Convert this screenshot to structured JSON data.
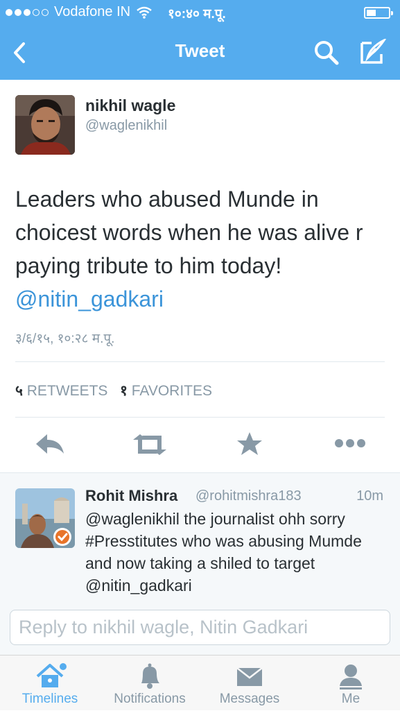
{
  "status_bar": {
    "carrier": "Vodafone IN",
    "time": "१०:४० म.पू.",
    "signal_bars": 5,
    "signal_filled": 3
  },
  "nav": {
    "title": "Tweet",
    "back_icon": "chevron-left-icon",
    "search_icon": "search-icon",
    "compose_icon": "compose-icon"
  },
  "tweet": {
    "author_name": "nikhil wagle",
    "author_handle": "@waglenikhil",
    "text": "Leaders who abused Munde in choicest words when he was alive r paying tribute to him today!",
    "mention": "@nitin_gadkari",
    "timestamp": "३/६/१५, १०:२८ म.पू.",
    "retweets_count": "५",
    "retweets_label": "RETWEETS",
    "favorites_count": "१",
    "favorites_label": "FAVORITES"
  },
  "actions": {
    "reply_icon": "reply-icon",
    "retweet_icon": "retweet-icon",
    "favorite_icon": "star-icon",
    "more_icon": "more-icon"
  },
  "reply": {
    "name": "Rohit Mishra",
    "handle": "@rohitmishra183",
    "time": "10m",
    "text": "@waglenikhil the journalist ohh sorry #Presstitutes who was abusing Mumde and now taking a shiled to target  @nitin_gadkari"
  },
  "compose": {
    "placeholder": "Reply to nikhil wagle, Nitin Gadkari"
  },
  "tabs": [
    {
      "label": "Timelines",
      "icon": "home-icon",
      "active": true
    },
    {
      "label": "Notifications",
      "icon": "bell-icon",
      "active": false
    },
    {
      "label": "Messages",
      "icon": "envelope-icon",
      "active": false
    },
    {
      "label": "Me",
      "icon": "person-icon",
      "active": false
    }
  ],
  "colors": {
    "brand": "#55acee",
    "link": "#3b94d9",
    "muted": "#8899a6",
    "text": "#292f33"
  }
}
